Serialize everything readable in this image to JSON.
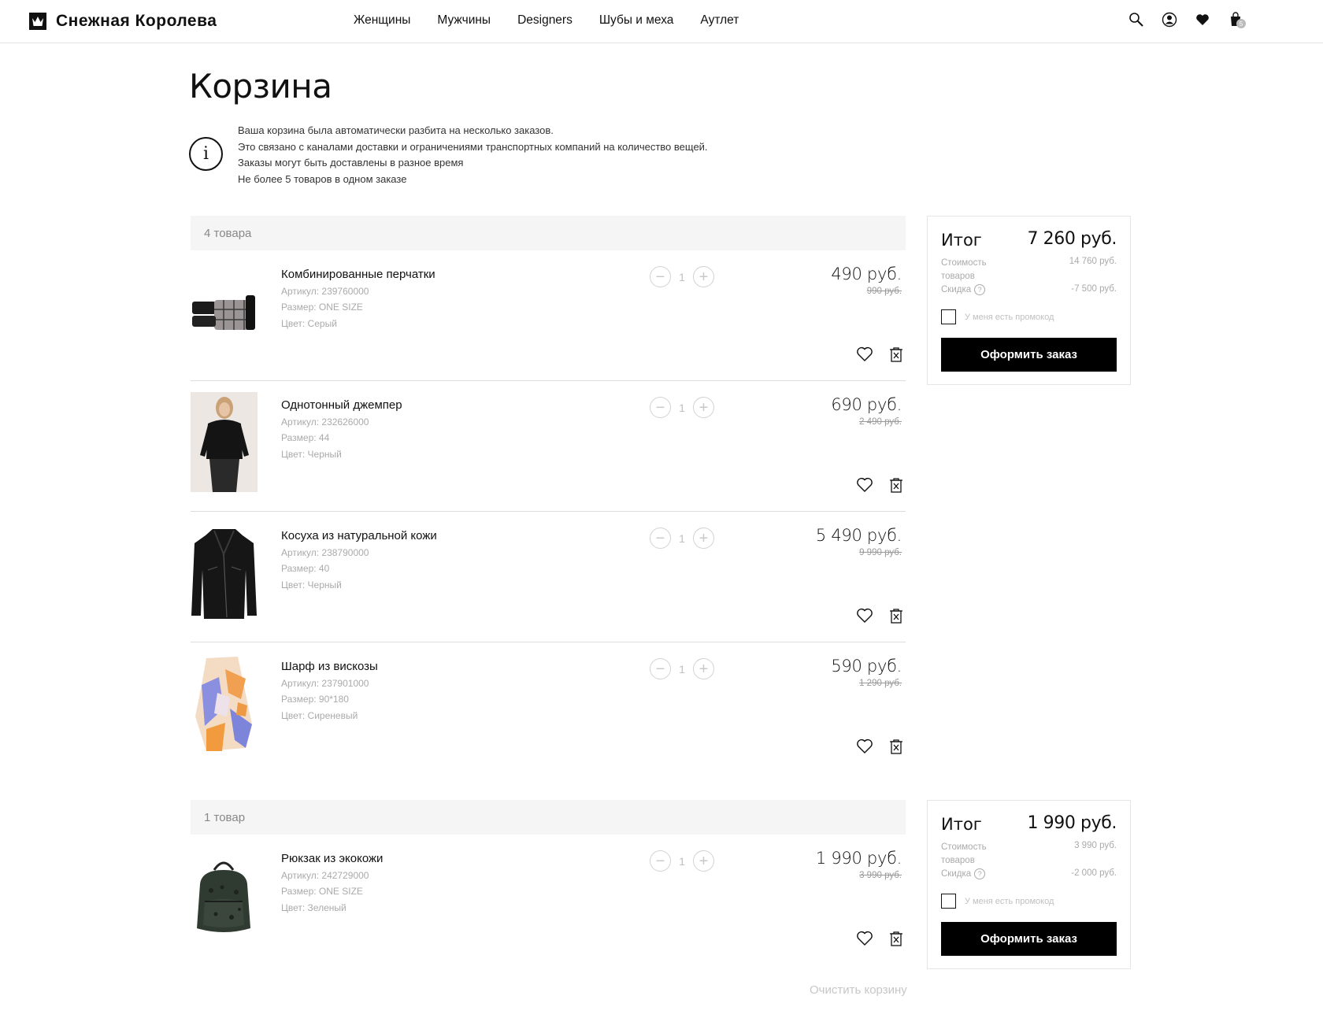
{
  "brand": {
    "name": "Снежная Королева"
  },
  "nav": [
    "Женщины",
    "Мужчины",
    "Designers",
    "Шубы и меха",
    "Аутлет"
  ],
  "header_icons": [
    "search-icon",
    "account-icon",
    "favorites-icon",
    "cart-icon"
  ],
  "page": {
    "title": "Корзина",
    "info": [
      "Ваша корзина была автоматически разбита на несколько заказов.",
      "Это связано с каналами доставки и ограничениями транспортных компаний на количество вещей.",
      "Заказы могут быть доставлены в разное время",
      "Не более 5 товаров в одном заказе"
    ]
  },
  "orders": [
    {
      "count_label": "4 товара",
      "items": [
        {
          "name": "Комбинированные перчатки",
          "article": "Артикул: 239760000",
          "size": "Размер: ONE SIZE",
          "color": "Цвет: Серый",
          "qty": "1",
          "price": "490 руб.",
          "old_price": "990 руб."
        },
        {
          "name": "Однотонный джемпер",
          "article": "Артикул: 232626000",
          "size": "Размер: 44",
          "color": "Цвет: Черный",
          "qty": "1",
          "price": "690 руб.",
          "old_price": "2 490 руб."
        },
        {
          "name": "Косуха из натуральной кожи",
          "article": "Артикул: 238790000",
          "size": "Размер: 40",
          "color": "Цвет: Черный",
          "qty": "1",
          "price": "5 490 руб.",
          "old_price": "9 990 руб."
        },
        {
          "name": "Шарф из вискозы",
          "article": "Артикул: 237901000",
          "size": "Размер: 90*180",
          "color": "Цвет: Сиреневый",
          "qty": "1",
          "price": "590 руб.",
          "old_price": "1 290 руб."
        }
      ],
      "summary": {
        "title": "Итог",
        "total": "7 260 руб.",
        "cost_label": "Стоимость товаров",
        "cost_value": "14 760 руб.",
        "discount_label": "Скидка",
        "discount_value": "-7 500 руб.",
        "promo_label": "У меня есть промокод",
        "button": "Оформить заказ"
      }
    },
    {
      "count_label": "1 товар",
      "items": [
        {
          "name": "Рюкзак из экокожи",
          "article": "Артикул: 242729000",
          "size": "Размер: ONE SIZE",
          "color": "Цвет: Зеленый",
          "qty": "1",
          "price": "1 990 руб.",
          "old_price": "3 990 руб."
        }
      ],
      "summary": {
        "title": "Итог",
        "total": "1 990 руб.",
        "cost_label": "Стоимость товаров",
        "cost_value": "3 990 руб.",
        "discount_label": "Скидка",
        "discount_value": "-2 000 руб.",
        "promo_label": "У меня есть промокод",
        "button": "Оформить заказ"
      }
    }
  ],
  "clear_cart": "Очистить корзину",
  "cart_count": "5",
  "colors": {
    "accent": "#000000",
    "muted": "#aaaaaa",
    "group_bg": "#f6f5f6"
  }
}
